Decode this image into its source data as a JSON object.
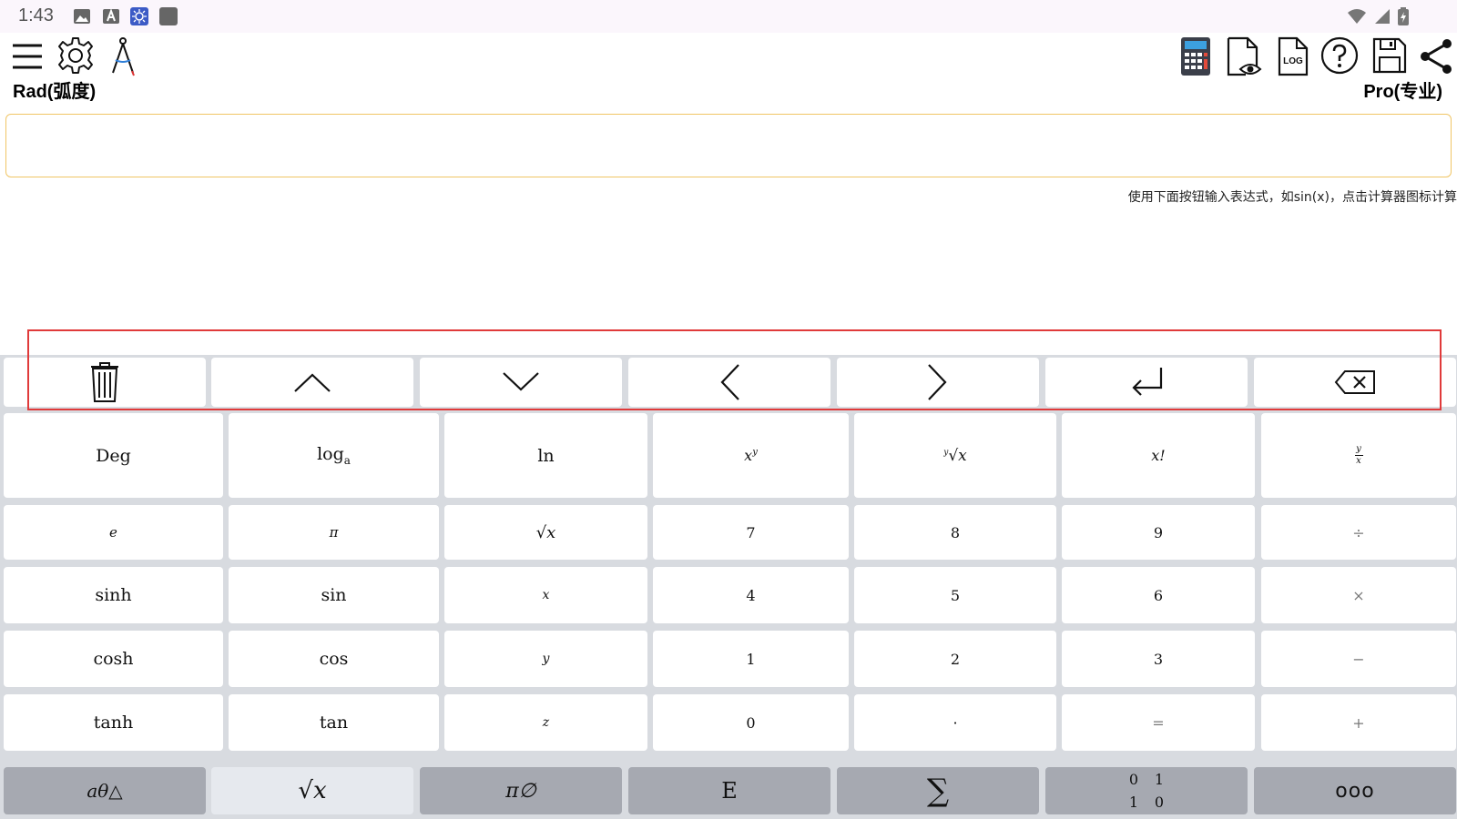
{
  "status_bar": {
    "time": "1:43"
  },
  "toolbar": {
    "angle_mode": "Rad(弧度)",
    "edition": "Pro(专业)",
    "log_icon_text": "LOG"
  },
  "expression": {
    "value": "",
    "hint": "使用下面按钮输入表达式，如sin(x)，点击计算器图标计算"
  },
  "nav_keys": [
    "clear",
    "up",
    "down",
    "left",
    "right",
    "enter",
    "backspace"
  ],
  "keys": {
    "row1": [
      "Deg",
      "log",
      "a",
      "ln",
      "x",
      "y",
      "y",
      "√x",
      "x!",
      "y",
      "x"
    ],
    "row2": [
      "e",
      "π",
      "√x",
      "7",
      "8",
      "9",
      "÷"
    ],
    "row3": [
      "sinh",
      "sin",
      "x",
      "4",
      "5",
      "6",
      "×"
    ],
    "row4": [
      "cosh",
      "cos",
      "y",
      "1",
      "2",
      "3",
      "−"
    ],
    "row5": [
      "tanh",
      "tan",
      "z",
      "0",
      "·",
      "=",
      "+"
    ]
  },
  "bottom_tabs": [
    "aθ△",
    "√x",
    "π∅",
    "E",
    "∑",
    "0",
    "1",
    "1",
    "0",
    "ooo"
  ],
  "colors": {
    "highlight": "#e03a3a",
    "input_border": "#f0c565",
    "keyboard_bg": "#d8dbe0",
    "bottom_tab_bg": "#a6a9b1"
  }
}
